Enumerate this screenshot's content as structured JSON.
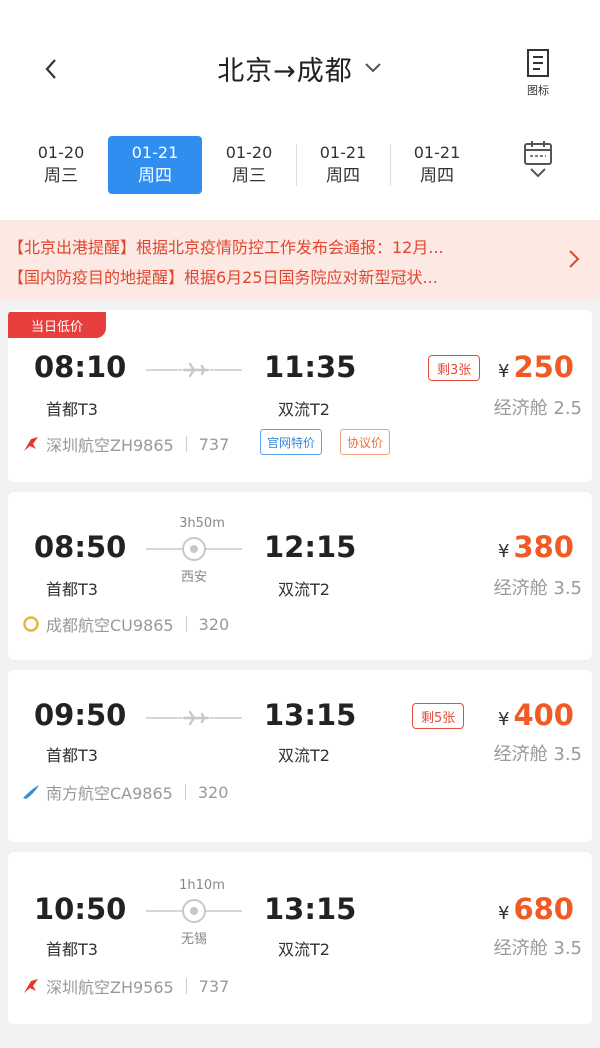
{
  "header": {
    "back_icon": "chevron-left-icon",
    "title": "北京→成都",
    "title_dropdown_icon": "chevron-down-icon",
    "menu_label": "图标"
  },
  "date_tabs": [
    {
      "date": "01-20",
      "weekday": "周三",
      "active": false
    },
    {
      "date": "01-21",
      "weekday": "周四",
      "active": true
    },
    {
      "date": "01-20",
      "weekday": "周三",
      "active": false
    },
    {
      "date": "01-21",
      "weekday": "周四",
      "active": false
    },
    {
      "date": "01-21",
      "weekday": "周四",
      "active": false
    }
  ],
  "notices": [
    "【北京出港提醒】根据北京疫情防控工作发布会通报：12月...",
    "【国内防疫目的地提醒】根据6月25日国务院应对新型冠状..."
  ],
  "flights": [
    {
      "badge": "当日低价",
      "dep_time": "08:10",
      "dep_airport": "首都T3",
      "arr_time": "11:35",
      "arr_airport": "双流T2",
      "remaining": "剩3张",
      "currency": "¥",
      "price": "250",
      "cabin": "经济舱 2.5",
      "airline": "深圳航空ZH9865",
      "aircraft": "737",
      "tags": [
        "官网特价",
        "协议价"
      ]
    },
    {
      "duration": "3h50m",
      "stop": "西安",
      "dep_time": "08:50",
      "dep_airport": "首都T3",
      "arr_time": "12:15",
      "arr_airport": "双流T2",
      "currency": "¥",
      "price": "380",
      "cabin": "经济舱 3.5",
      "airline": "成都航空CU9865",
      "aircraft": "320"
    },
    {
      "dep_time": "09:50",
      "dep_airport": "首都T3",
      "arr_time": "13:15",
      "arr_airport": "双流T2",
      "remaining": "剩5张",
      "currency": "¥",
      "price": "400",
      "cabin": "经济舱 3.5",
      "airline": "南方航空CA9865",
      "aircraft": "320"
    },
    {
      "duration": "1h10m",
      "stop": "无锡",
      "dep_time": "10:50",
      "dep_airport": "首都T3",
      "arr_time": "13:15",
      "arr_airport": "双流T2",
      "currency": "¥",
      "price": "680",
      "cabin": "经济舱 3.5",
      "airline": "深圳航空ZH9565",
      "aircraft": "737"
    }
  ],
  "colors": {
    "accent_blue": "#2f8ef0",
    "price_orange": "#f05a24",
    "notice_bg": "#fde9e4",
    "notice_text": "#e0462f"
  }
}
